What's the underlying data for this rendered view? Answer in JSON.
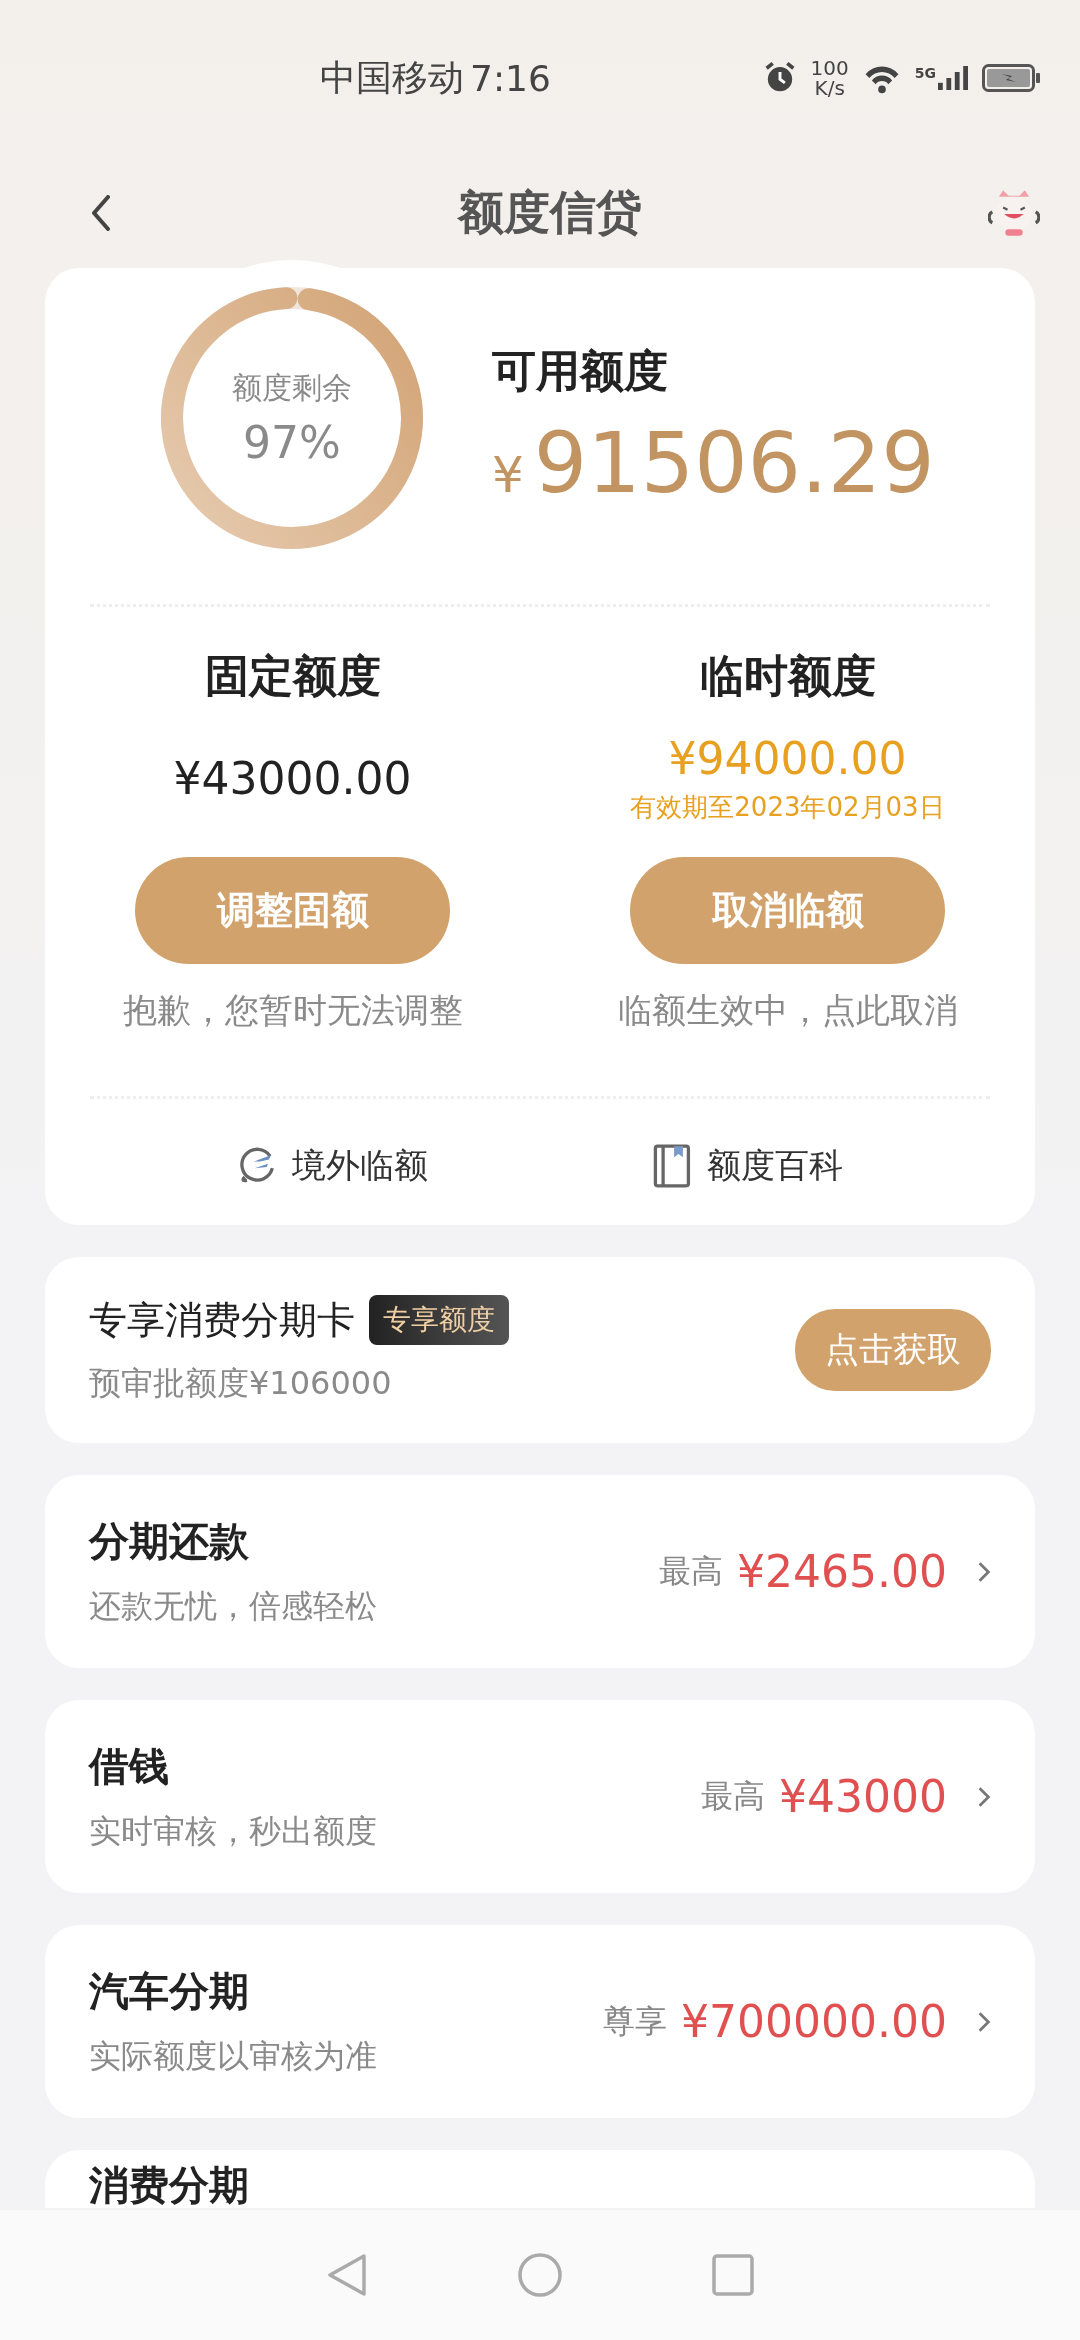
{
  "status_bar": {
    "carrier": "中国移动",
    "time": "7:16",
    "net_speed": [
      "100",
      "K/s"
    ],
    "network": "5G"
  },
  "header": {
    "title": "额度信贷"
  },
  "summary": {
    "ring_label": "额度剩余",
    "ring_percent": "97%",
    "level": 0.97,
    "available_label": "可用额度",
    "currency": "¥",
    "available_amount": "91506.29"
  },
  "quotas": [
    {
      "kind": "fixed",
      "title": "固定额度",
      "value": "¥43000.00",
      "button": "调整固额",
      "note": "抱歉，您暂时无法调整"
    },
    {
      "kind": "temporary",
      "title": "临时额度",
      "value": "¥94000.00",
      "validity": "有效期至2023年02月03日",
      "button": "取消临额",
      "note": "临额生效中，点此取消"
    }
  ],
  "links": [
    {
      "kind": "overseas",
      "label": "境外临额"
    },
    {
      "kind": "guide",
      "label": "额度百科"
    }
  ],
  "promo": {
    "title": "专享消费分期卡",
    "badge": "专享额度",
    "subtitle": "预审批额度¥106000",
    "button": "点击获取"
  },
  "products": [
    {
      "title": "分期还款",
      "subtitle": "还款无忧，倍感轻松",
      "prefix": "最高",
      "amount": "¥2465.00"
    },
    {
      "title": "借钱",
      "subtitle": "实时审核，秒出额度",
      "prefix": "最高",
      "amount": "¥43000"
    },
    {
      "title": "汽车分期",
      "subtitle": "实际额度以审核为准",
      "prefix": "尊享",
      "amount": "¥700000.00"
    },
    {
      "title": "消费分期"
    }
  ]
}
